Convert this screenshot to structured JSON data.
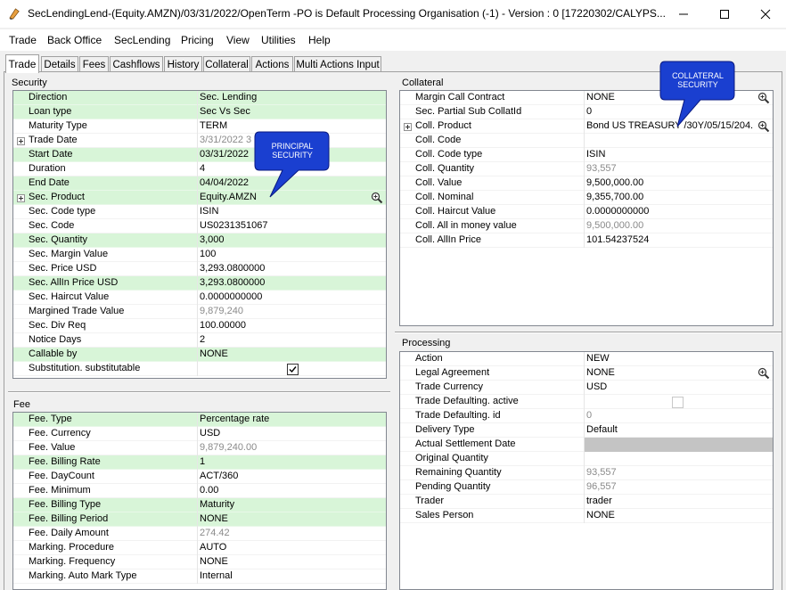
{
  "window": {
    "title": "SecLendingLend-(Equity.AMZN)/03/31/2022/OpenTerm  -PO is Default Processing Organisation  (-1) - Version : 0  [17220302/CALYPS...",
    "minimize_glyph": "—",
    "maximize_glyph": "☐",
    "close_glyph": "✕"
  },
  "menu": [
    "Trade",
    "Back Office",
    "SecLending",
    "Pricing",
    "View",
    "Utilities",
    "Help"
  ],
  "tabs": [
    "Trade",
    "Details",
    "Fees",
    "Cashflows",
    "History",
    "Collateral",
    "Actions",
    "Multi Actions Input"
  ],
  "active_tab": "Trade",
  "security": {
    "title": "Security",
    "rows": [
      {
        "label": "Direction",
        "value": "Sec. Lending",
        "hl": true
      },
      {
        "label": "Loan type",
        "value": "Sec Vs Sec",
        "hl": true
      },
      {
        "label": "Maturity Type",
        "value": "TERM"
      },
      {
        "label": "Trade Date",
        "value": "3/31/2022 3",
        "gray": true,
        "expand": true
      },
      {
        "label": "Start Date",
        "value": "03/31/2022",
        "hl": true
      },
      {
        "label": "Duration",
        "value": "4"
      },
      {
        "label": "End Date",
        "value": "04/04/2022",
        "hl": true
      },
      {
        "label": "Sec. Product",
        "value": "Equity.AMZN",
        "hl": true,
        "expand": true,
        "zoom": true
      },
      {
        "label": "Sec. Code type",
        "value": "ISIN"
      },
      {
        "label": "Sec. Code",
        "value": "US0231351067"
      },
      {
        "label": "Sec. Quantity",
        "value": "3,000",
        "hl": true
      },
      {
        "label": "Sec. Margin Value",
        "value": "100"
      },
      {
        "label": "Sec. Price USD",
        "value": "3,293.0800000"
      },
      {
        "label": "Sec. AllIn Price USD",
        "value": "3,293.0800000",
        "hl": true
      },
      {
        "label": "Sec. Haircut Value",
        "value": "0.0000000000"
      },
      {
        "label": "Margined Trade Value",
        "value": "9,879,240",
        "gray": true
      },
      {
        "label": "Sec. Div Req",
        "value": "100.00000"
      },
      {
        "label": "Notice Days",
        "value": "2"
      },
      {
        "label": "Callable by",
        "value": "NONE",
        "hl": true
      },
      {
        "label": "Substitution. substitutable",
        "value": "",
        "check": "checked"
      }
    ]
  },
  "fee": {
    "title": "Fee",
    "rows": [
      {
        "label": "Fee. Type",
        "value": "Percentage rate",
        "hl": true
      },
      {
        "label": "Fee. Currency",
        "value": "USD"
      },
      {
        "label": "Fee. Value",
        "value": "9,879,240.00",
        "gray": true
      },
      {
        "label": "Fee. Billing Rate",
        "value": "1",
        "hl": true
      },
      {
        "label": "Fee. DayCount",
        "value": "ACT/360"
      },
      {
        "label": "Fee. Minimum",
        "value": "0.00"
      },
      {
        "label": "Fee. Billing Type",
        "value": "Maturity",
        "hl": true
      },
      {
        "label": "Fee. Billing Period",
        "value": "NONE",
        "hl": true
      },
      {
        "label": "Fee. Daily Amount",
        "value": "274.42",
        "gray": true
      },
      {
        "label": "Marking. Procedure",
        "value": "AUTO"
      },
      {
        "label": "Marking. Frequency",
        "value": "NONE"
      },
      {
        "label": "Marking. Auto Mark Type",
        "value": "Internal"
      }
    ]
  },
  "collateral": {
    "title": "Collateral",
    "rows": [
      {
        "label": "Margin Call Contract",
        "value": "NONE",
        "zoom": true
      },
      {
        "label": "Sec. Partial Sub CollatId",
        "value": "0"
      },
      {
        "label": "Coll. Product",
        "value": "Bond US TREASURY /30Y/05/15/204...",
        "expand": true,
        "zoom": true
      },
      {
        "label": "Coll. Code",
        "value": ""
      },
      {
        "label": "Coll. Code type",
        "value": "ISIN"
      },
      {
        "label": "Coll. Quantity",
        "value": "93,557",
        "gray": true
      },
      {
        "label": "Coll. Value",
        "value": "9,500,000.00"
      },
      {
        "label": "Coll. Nominal",
        "value": "9,355,700.00"
      },
      {
        "label": "Coll. Haircut Value",
        "value": "0.0000000000"
      },
      {
        "label": "Coll. All in money value",
        "value": "9,500,000.00",
        "gray": true
      },
      {
        "label": "Coll. AllIn Price",
        "value": "101.54237524"
      }
    ]
  },
  "processing": {
    "title": "Processing",
    "rows": [
      {
        "label": "Action",
        "value": "NEW"
      },
      {
        "label": "Legal Agreement",
        "value": "NONE",
        "zoom": true
      },
      {
        "label": "Trade Currency",
        "value": "USD"
      },
      {
        "label": "Trade Defaulting. active",
        "value": "",
        "check": "empty"
      },
      {
        "label": "Trade Defaulting. id",
        "value": "0",
        "gray": true
      },
      {
        "label": "Delivery Type",
        "value": "Default"
      },
      {
        "label": "Actual Settlement Date",
        "value": "",
        "grayfill": true
      },
      {
        "label": "Original Quantity",
        "value": ""
      },
      {
        "label": "Remaining Quantity",
        "value": "93,557",
        "gray": true
      },
      {
        "label": "Pending Quantity",
        "value": "96,557",
        "gray": true
      },
      {
        "label": "Trader",
        "value": "trader"
      },
      {
        "label": "Sales Person",
        "value": "NONE"
      }
    ]
  },
  "callouts": {
    "principal": "PRINCIPAL SECURITY",
    "collateral": "COLLATERAL SECURITY",
    "color": "#1a3fd0"
  },
  "colors": {
    "highlight_row": "#d8f5d8",
    "grid_border": "#828790",
    "window_bg": "#f0f0f0"
  }
}
